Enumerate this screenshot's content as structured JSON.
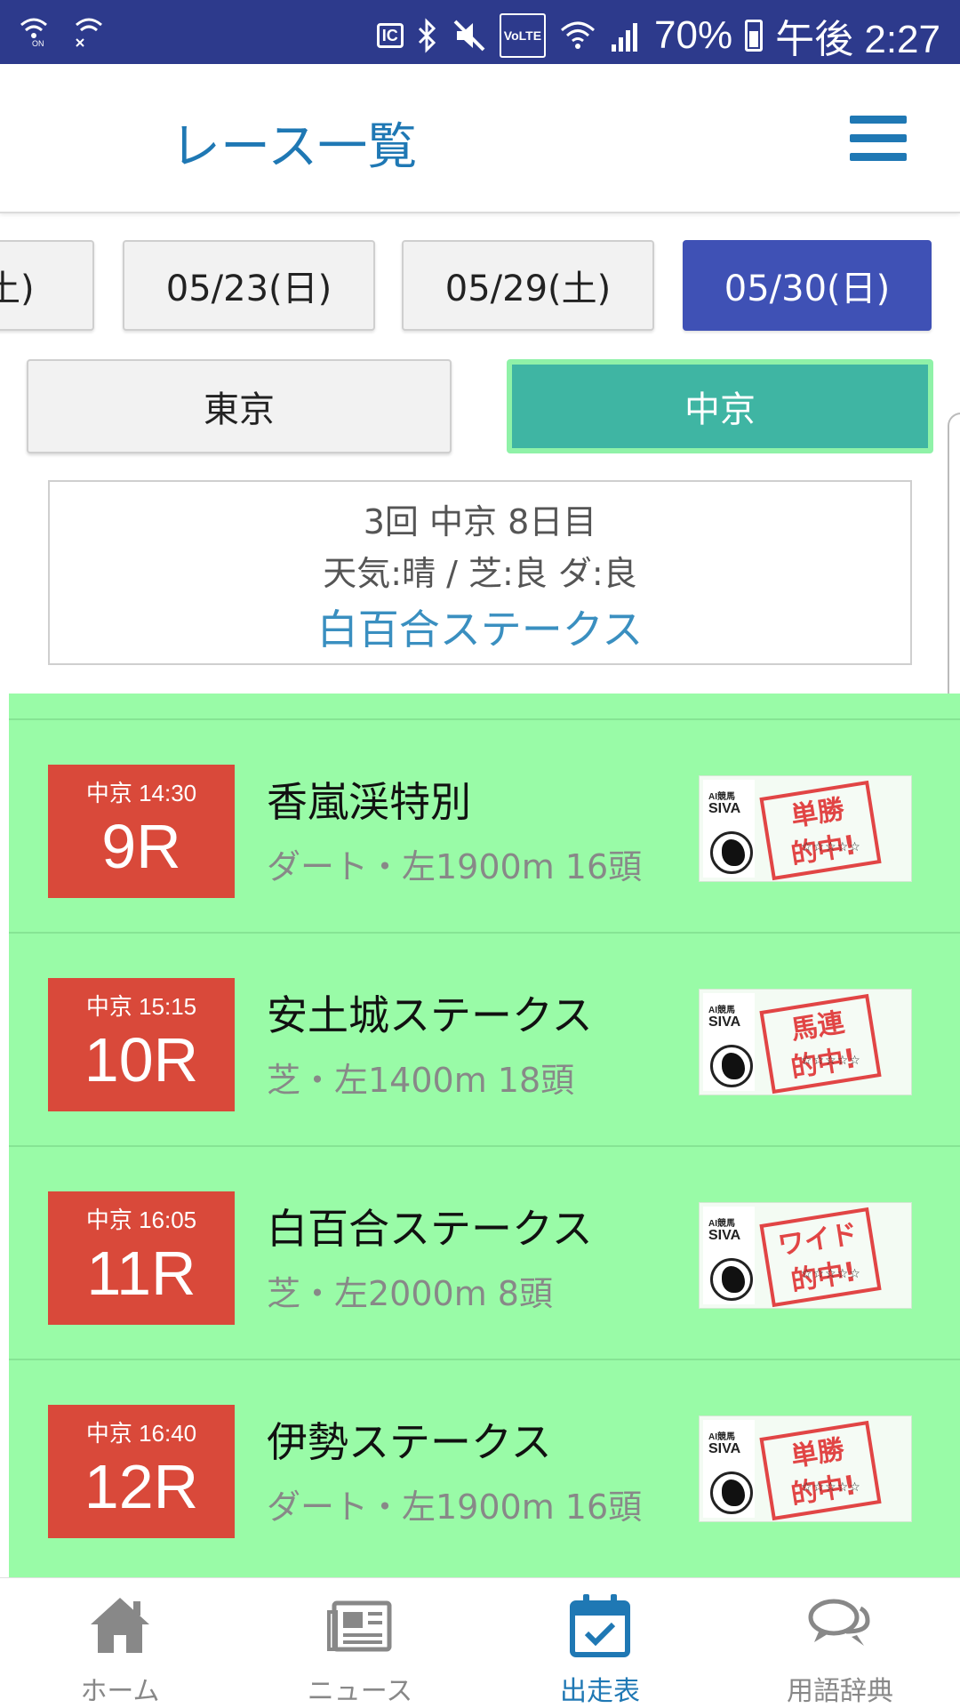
{
  "status_bar": {
    "battery": "70%",
    "time": "午後 2:27",
    "ic_label": "IC",
    "volte_label": "VoLTE",
    "icons": [
      "wifi-call-on-icon",
      "wifi-off-icon",
      "ic-card-icon",
      "bluetooth-icon",
      "mute-icon",
      "volte-icon",
      "wifi-icon",
      "signal-icon",
      "battery-icon"
    ]
  },
  "header": {
    "title": "レース一覧",
    "menu_icon": "hamburger-menu-icon"
  },
  "dates": [
    {
      "label": "(土)",
      "active": false
    },
    {
      "label": "05/23(日)",
      "active": false
    },
    {
      "label": "05/29(土)",
      "active": false
    },
    {
      "label": "05/30(日)",
      "active": true
    }
  ],
  "venues": [
    {
      "label": "東京",
      "active": false
    },
    {
      "label": "中京",
      "active": true
    }
  ],
  "meeting_info": {
    "session": "3回 中京 8日目",
    "conditions": "天気:晴 / 芝:良  ダ:良",
    "feature_race": "白百合ステークス"
  },
  "races": [
    {
      "time": "中京 14:30",
      "number": "9R",
      "name": "香嵐渓特別",
      "detail": "ダート・左1900m 16頭",
      "stamp_top": "単勝",
      "stamp_bottom": "的中!"
    },
    {
      "time": "中京 15:15",
      "number": "10R",
      "name": "安土城ステークス",
      "detail": "芝・左1400m 18頭",
      "stamp_top": "馬連",
      "stamp_bottom": "的中!"
    },
    {
      "time": "中京 16:05",
      "number": "11R",
      "name": "白百合ステークス",
      "detail": "芝・左2000m 8頭",
      "stamp_top": "ワイド",
      "stamp_bottom": "的中!"
    },
    {
      "time": "中京 16:40",
      "number": "12R",
      "name": "伊勢ステークス",
      "detail": "ダート・左1900m 16頭",
      "stamp_top": "単勝",
      "stamp_bottom": "的中!"
    }
  ],
  "siva": {
    "small_label": "AI競馬",
    "name": "SIVA",
    "stars": "☆☆☆☆☆"
  },
  "nav": [
    {
      "label": "ホーム",
      "icon": "home-icon",
      "active": false
    },
    {
      "label": "ニュース",
      "icon": "newspaper-icon",
      "active": false
    },
    {
      "label": "出走表",
      "icon": "calendar-check-icon",
      "active": true
    },
    {
      "label": "用語辞典",
      "icon": "chat-bubbles-icon",
      "active": false
    }
  ],
  "colors": {
    "status_bar": "#2d3a8c",
    "title_blue": "#1f78b4",
    "date_active": "#3f51b5",
    "venue_active": "#3fb5a3",
    "list_bg": "#99fba7",
    "race_badge": "#d9493a",
    "stamp_red": "#e14545"
  }
}
